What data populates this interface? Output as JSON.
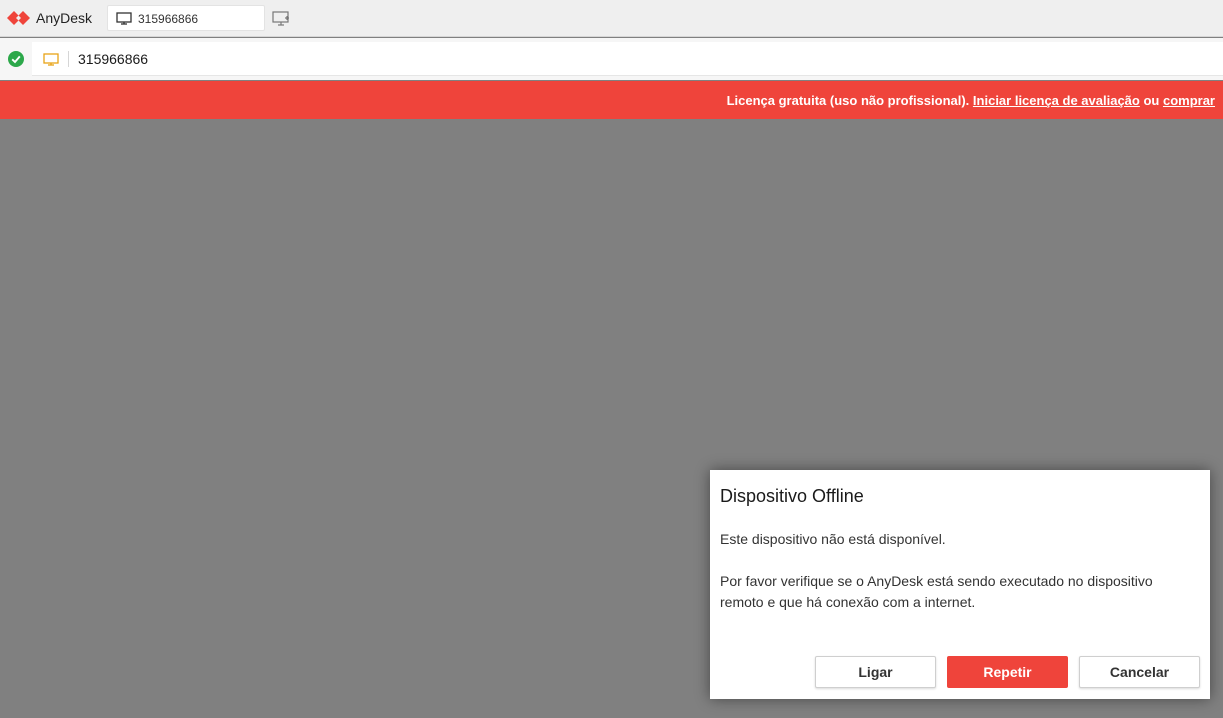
{
  "app": {
    "name": "AnyDesk",
    "brand_color": "#ef443b"
  },
  "tab": {
    "label": "315966866",
    "icon": "monitor-icon"
  },
  "toolbar": {
    "new_tab_icon": "new-session-icon"
  },
  "address_bar": {
    "status_icon": "connected-check-icon",
    "status_color": "#2ca84a",
    "device_icon": "monitor-icon",
    "value": "315966866"
  },
  "banner": {
    "prefix": "Licença gratuita (uso não profissional). ",
    "link_trial": "Iniciar licença de avaliação",
    "middle": " ou ",
    "link_buy": "comprar",
    "background": "#ef443b"
  },
  "dialog": {
    "title": "Dispositivo Offline",
    "message_1": "Este dispositivo não está disponível.",
    "message_2": "Por favor verifique se o AnyDesk está sendo executado no dispositivo remoto e que há conexão com a internet.",
    "buttons": {
      "connect": "Ligar",
      "retry": "Repetir",
      "cancel": "Cancelar"
    }
  }
}
